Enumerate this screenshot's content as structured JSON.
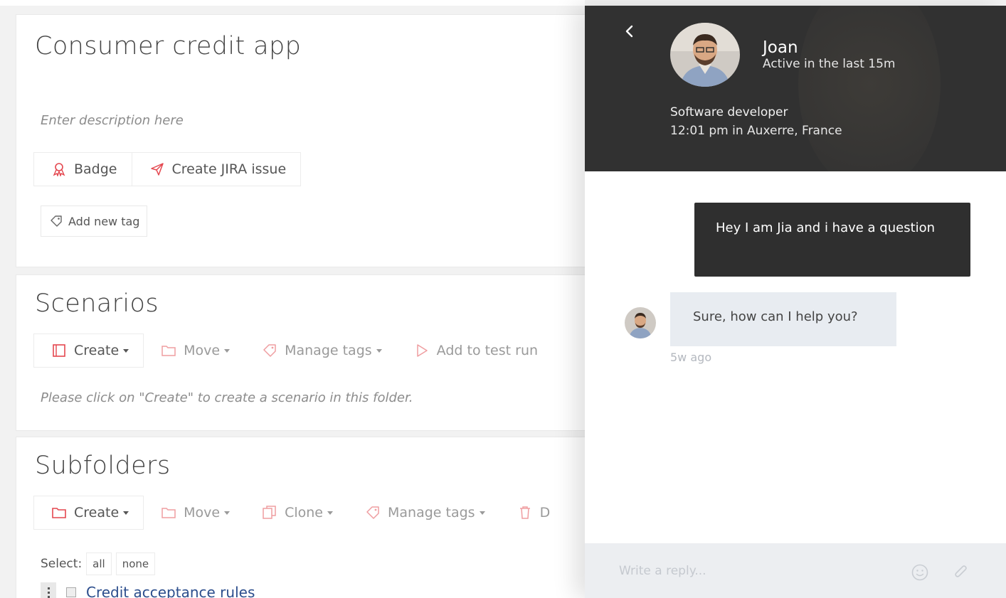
{
  "app": {
    "title": "Consumer credit app",
    "description_placeholder": "Enter description here",
    "actions": {
      "badge": "Badge",
      "jira": "Create JIRA issue"
    },
    "add_tag": "Add new tag"
  },
  "scenarios": {
    "title": "Scenarios",
    "toolbar": {
      "create": "Create",
      "move": "Move",
      "manage_tags": "Manage tags",
      "add_to_test_run": "Add to test run"
    },
    "hint": "Please click on \"Create\" to create a scenario in this folder."
  },
  "subfolders": {
    "title": "Subfolders",
    "toolbar": {
      "create": "Create",
      "move": "Move",
      "clone": "Clone",
      "manage_tags": "Manage tags",
      "delete_partial": "D"
    },
    "select_label": "Select:",
    "select_all": "all",
    "select_none": "none",
    "items": [
      "Credit acceptance rules"
    ]
  },
  "chat": {
    "agent": {
      "name": "Joan",
      "status": "Active in the last 15m",
      "role": "Software developer",
      "local_time": "12:01 pm in Auxerre, France"
    },
    "messages": [
      {
        "direction": "outgoing",
        "text": "Hey I am Jia and i have a question"
      },
      {
        "direction": "incoming",
        "text": "Sure, how can I help you?",
        "time": "5w ago"
      }
    ],
    "reply_placeholder": "Write a reply..."
  },
  "colors": {
    "accent": "#e4474f",
    "chat_header": "#313131",
    "link": "#2b4d8c",
    "incoming_bubble": "#e8ecf1"
  },
  "icons": [
    "badge-icon",
    "send-icon",
    "tag-icon",
    "scenario-icon",
    "folder-icon",
    "clone-icon",
    "play-icon",
    "trash-icon",
    "chevron-left-icon",
    "emoji-icon",
    "paperclip-icon",
    "drag-handle-icon"
  ]
}
